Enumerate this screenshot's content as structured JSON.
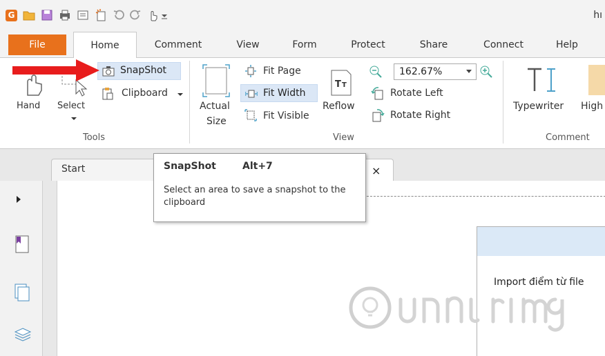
{
  "window": {
    "title_fragment": "hı"
  },
  "menu_tabs": [
    {
      "label": "File"
    },
    {
      "label": "Home"
    },
    {
      "label": "Comment"
    },
    {
      "label": "View"
    },
    {
      "label": "Form"
    },
    {
      "label": "Protect"
    },
    {
      "label": "Share"
    },
    {
      "label": "Connect"
    },
    {
      "label": "Help"
    }
  ],
  "tools_group": {
    "hand": "Hand",
    "select": "Select",
    "snapshot": "SnapShot",
    "clipboard": "Clipboard",
    "label": "Tools"
  },
  "view_group": {
    "actual_size_line1": "Actual",
    "actual_size_line2": "Size",
    "fit_page": "Fit Page",
    "fit_width": "Fit Width",
    "fit_visible": "Fit Visible",
    "reflow": "Reflow",
    "zoom_value": "162.67%",
    "rotate_left": "Rotate Left",
    "rotate_right": "Rotate Right",
    "label": "View"
  },
  "comment_group": {
    "typewriter": "Typewriter",
    "highlight_fragment": "High",
    "label": "Comment"
  },
  "document": {
    "tab_start": "Start",
    "tab_close": "×"
  },
  "tooltip": {
    "title": "SnapShot",
    "shortcut": "Alt+7",
    "description": "Select an area to save a snapshot to the clipboard"
  },
  "dialog": {
    "text": "Import điểm từ file"
  },
  "colors": {
    "accent": "#e8711c",
    "highlight": "#dbe7f6",
    "arrow": "#e81c1c"
  }
}
